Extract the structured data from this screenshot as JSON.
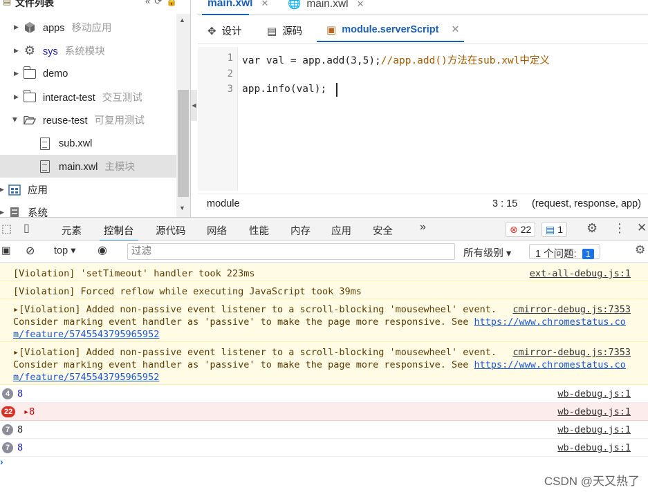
{
  "tree": {
    "title": "文件列表",
    "items": [
      {
        "label": "apps",
        "sub": "移动应用",
        "icon": "cube-icon"
      },
      {
        "label": "sys",
        "sub": "系统模块",
        "icon": "gear-icon"
      },
      {
        "label": "demo",
        "sub": "",
        "icon": "folder-icon"
      },
      {
        "label": "interact-test",
        "sub": "交互测试",
        "icon": "folder-icon"
      },
      {
        "label": "reuse-test",
        "sub": "可复用测试",
        "icon": "folder-open-icon"
      },
      {
        "label": "sub.xwl",
        "sub": "",
        "icon": "file-icon"
      },
      {
        "label": "main.xwl",
        "sub": "主模块",
        "icon": "file-icon"
      },
      {
        "label": "应用",
        "sub": "",
        "icon": "app-grid-icon"
      },
      {
        "label": "系统",
        "sub": "",
        "icon": "system-icon"
      }
    ]
  },
  "file_tabs": [
    {
      "label": "main.xwl",
      "active": true
    },
    {
      "label": "main.xwl",
      "active": false
    }
  ],
  "sub_tabs": [
    {
      "label": "设计"
    },
    {
      "label": "源码"
    },
    {
      "label": "module.serverScript"
    }
  ],
  "code": {
    "lines": [
      {
        "num": "1",
        "code": "var val = app.add(3,5);",
        "comment": "//app.add()方法在sub.xwl中定义"
      },
      {
        "num": "2",
        "code": "",
        "comment": ""
      },
      {
        "num": "3",
        "code": "app.info(val);",
        "comment": ""
      }
    ]
  },
  "editor_status": {
    "name": "module",
    "pos": "3 : 15",
    "params": "(request, response, app)"
  },
  "devtools": {
    "tabs": [
      "元素",
      "控制台",
      "源代码",
      "网络",
      "性能",
      "内存",
      "应用",
      "安全"
    ],
    "active_tab": "控制台",
    "error_count": "22",
    "message_count": "1"
  },
  "filter": {
    "context": "top",
    "placeholder": "过滤",
    "levels": "所有级别",
    "issues_label": "1 个问题:",
    "issues_count": "1"
  },
  "console": {
    "warnings": [
      {
        "text": "[Violation] 'setTimeout' handler took 223ms",
        "source": "ext-all-debug.js:1"
      },
      {
        "text": "[Violation] Forced reflow while executing JavaScript took 39ms",
        "source": ""
      },
      {
        "line1": "▸[Violation] Added non-passive event listener to a scroll-blocking 'mousewheel' event.",
        "source": "cmirror-debug.js:7353",
        "line2": "Consider marking event handler as 'passive' to make the page more responsive. See ",
        "link1": "https://www.chromestatus.co",
        "link2": "m/feature/5745543795965952"
      },
      {
        "line1": "▸[Violation] Added non-passive event listener to a scroll-blocking 'mousewheel' event.",
        "source": "cmirror-debug.js:7353",
        "line2": "Consider marking event handler as 'passive' to make the page more responsive. See ",
        "link1": "https://www.chromestatus.co",
        "link2": "m/feature/5745543795965952"
      }
    ],
    "rows": [
      {
        "count": "4",
        "value": "8",
        "source": "wb-debug.js:1",
        "error": false
      },
      {
        "count": "22",
        "value": "▸8",
        "source": "wb-debug.js:1",
        "error": true
      },
      {
        "count": "7",
        "value": "8",
        "source": "wb-debug.js:1",
        "error": false
      },
      {
        "count": "7",
        "value": "8",
        "source": "wb-debug.js:1",
        "error": false
      }
    ],
    "prompt": "›"
  },
  "watermark": "CSDN @天又热了"
}
